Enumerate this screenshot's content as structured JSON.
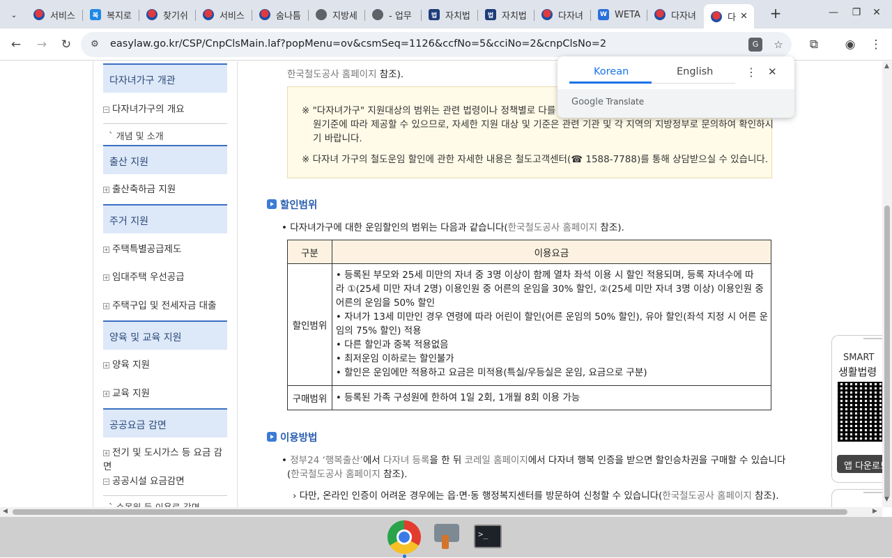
{
  "browser": {
    "tabs": [
      {
        "label": "서비스",
        "icon": "korea-gov-icon"
      },
      {
        "label": "복지로",
        "icon": "bokjiro-icon"
      },
      {
        "label": "찾기쉬",
        "icon": "korea-gov-icon"
      },
      {
        "label": "서비스",
        "icon": "korea-gov-icon"
      },
      {
        "label": "숨나틈",
        "icon": "korea-gov-icon"
      },
      {
        "label": "지방세",
        "icon": "globe-icon"
      },
      {
        "label": "- 업무",
        "icon": "globe-icon"
      },
      {
        "label": "자치법",
        "icon": "law-icon"
      },
      {
        "label": "자치법",
        "icon": "law-icon"
      },
      {
        "label": "다자녀",
        "icon": "korea-gov-icon"
      },
      {
        "label": "WETA",
        "icon": "w-icon"
      },
      {
        "label": "다자녀",
        "icon": "korea-gov-icon"
      },
      {
        "label": "다",
        "icon": "korea-gov-icon"
      }
    ],
    "url": "easylaw.go.kr/CSP/CnpClsMain.laf?popMenu=ov&csmSeq=1126&ccfNo=5&cciNo=2&cnpClsNo=2"
  },
  "translate_popup": {
    "lang_source": "Korean",
    "lang_target": "English",
    "footer_google": "Google",
    "footer_translate": "Translate"
  },
  "sidebar": {
    "sections": [
      {
        "head": "다자녀가구 개관",
        "items": [
          "다자녀가구의 개요"
        ],
        "sub": "ˋ 개념 및 소개"
      },
      {
        "head": "출산 지원",
        "items": [
          "출산축하금 지원"
        ]
      },
      {
        "head": "주거 지원",
        "items": [
          "주택특별공급제도",
          "임대주택 우선공급",
          "주택구입 및 전세자금 대출"
        ]
      },
      {
        "head": "양육 및 교육 지원",
        "items": [
          "양육 지원",
          "교육 지원"
        ]
      },
      {
        "head": "공공요금 감면",
        "items": [
          "전기 및 도시가스 등 요금 감면",
          "공공시설 요금감면"
        ],
        "sub": "ˋ 수목원 등 이용료 감면"
      }
    ]
  },
  "content": {
    "top_link": "한국철도공사 홈페이지",
    "top_suffix": " 참조).",
    "note_lines": [
      "※ \"다자녀가구\" 지원대상의 범위는 관련 법령이나 정책별로 다를 수",
      "원기준에 따라 제공할 수 있으므로, 자세한 지원 대상 및 기준은 관련 기관 및 각 지역의 지방정부로 문의하여 확인하시",
      "기 바랍니다.",
      "※ 다자녀 가구의 철도운임 할인에 관한 자세한 내용은 철도고객센터(☎ 1588-7788)를 통해 상담받으실 수 있습니다."
    ],
    "section1_title": "할인범위",
    "section1_intro_pre": "• 다자녀가구에 대한 운임할인의 범위는 다음과 같습니다(",
    "section1_intro_link": "한국철도공사 홈페이지",
    "section1_intro_post": " 참조).",
    "table": {
      "headers": [
        "구분",
        "이용요금"
      ],
      "rows": [
        {
          "label": "할인범위",
          "lines": [
            "• 등록된 부모와 25세 미만의 자녀 중 3명 이상이 함께 열차 좌석 이용 시 할인 적용되며, 등록 자녀수에 따",
            "라 ①(25세 미만 자녀 2명) 이용인원 중 어른의 운임을 30% 할인, ②(25세 미만 자녀 3명 이상) 이용인원 중",
            "어른의 운임을 50% 할인",
            "• 자녀가 13세 미만인 경우 연령에 따라 어린이 할인(어른 운임의 50% 할인), 유아 할인(좌석 지정 시 어른 운",
            "임의 75% 할인) 적용",
            "• 다른 할인과 중복 적용없음",
            "• 최저운임 이하로는 할인불가",
            "• 할인은 운임에만 적용하고 요금은 미적용(특실/우등실은 운임, 요금으로 구분)"
          ]
        },
        {
          "label": "구매범위",
          "lines": [
            "• 등록된 가족 구성원에 한하여 1일 2회, 1개월 8회 이용 가능"
          ]
        }
      ]
    },
    "section2_title": "이용방법",
    "section2_line1": {
      "pre": "• ",
      "link1": "정부24 ‘행복출산’",
      "mid1": "에서 ",
      "link2": "다자녀 등록",
      "mid2": "을 한 뒤 ",
      "link3": "코레일 홈페이지",
      "post": "에서 다자녀 행복 인증을 받으면 할인승차권을 구매할 수 있습니다"
    },
    "section2_line2": {
      "pre": "(",
      "link": "한국철도공사 홈페이지",
      "post": " 참조)."
    },
    "section2_line3": {
      "pre": "› 다만, 온라인 인증이 어려운 경우에는 읍·면·동 행정복지센터를 방문하여 신청할 수 있습니다(",
      "link": "한국철도공사 홈페이지",
      "post": " 참조)."
    }
  },
  "side_app": {
    "title1": "SMART",
    "title2": "생활법령",
    "download": "앱 다운로드"
  },
  "terminal_prompt": ">_"
}
